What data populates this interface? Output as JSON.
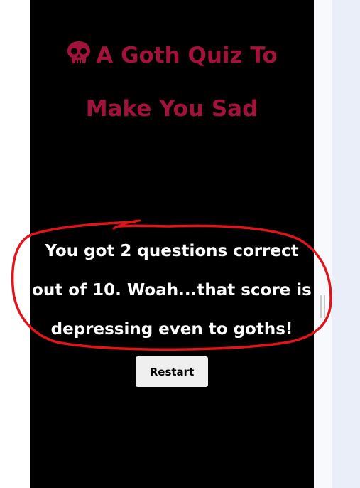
{
  "quiz": {
    "title_line1": "A Goth Quiz To",
    "title_line2": "Make You Sad",
    "title_icon": "skull-icon",
    "result_line1": "You got 2 questions correct",
    "result_line2": "out of 10. Woah...that score is",
    "result_line3": "depressing even to goths!",
    "restart_label": "Restart"
  },
  "colors": {
    "background": "#000000",
    "title": "#a3123a",
    "text": "#ffffff",
    "button": "#efefef",
    "annotation": "#e0141b"
  }
}
